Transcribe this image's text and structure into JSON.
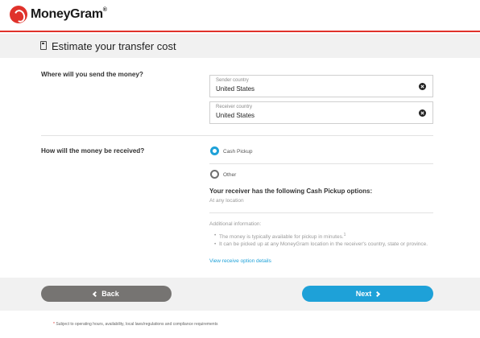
{
  "brand": {
    "name": "MoneyGram",
    "reg_mark": "®",
    "accent_color": "#e0322b"
  },
  "page": {
    "title": "Estimate your transfer cost",
    "title_icon": "calculator-icon"
  },
  "destination": {
    "question": "Where will you send the money?",
    "sender": {
      "label": "Sender country",
      "value": "United States"
    },
    "receiver": {
      "label": "Receiver country",
      "value": "United States"
    },
    "clear_icon": "clear-circle-icon"
  },
  "receive_method": {
    "question": "How will the money be received?",
    "options": [
      {
        "label": "Cash Pickup",
        "selected": true
      },
      {
        "label": "Other",
        "selected": false
      }
    ],
    "options_heading": "Your receiver has the following Cash Pickup options:",
    "options_sub": "At any location"
  },
  "additional_info": {
    "heading": "Additional information:",
    "items": [
      "The money is typically available for pickup in minutes.",
      "It can be picked up at any MoneyGram location in the receiver's country, state or province."
    ],
    "footnote_mark": "1",
    "link": "View receive option details"
  },
  "nav": {
    "back_label": "Back",
    "next_label": "Next",
    "back_color": "#767472",
    "next_color": "#1ea1d8"
  },
  "footer": {
    "asterisk": "*",
    "disclaimer": "Subject to operating hours, availability, local laws/regulations and compliance requirements"
  }
}
